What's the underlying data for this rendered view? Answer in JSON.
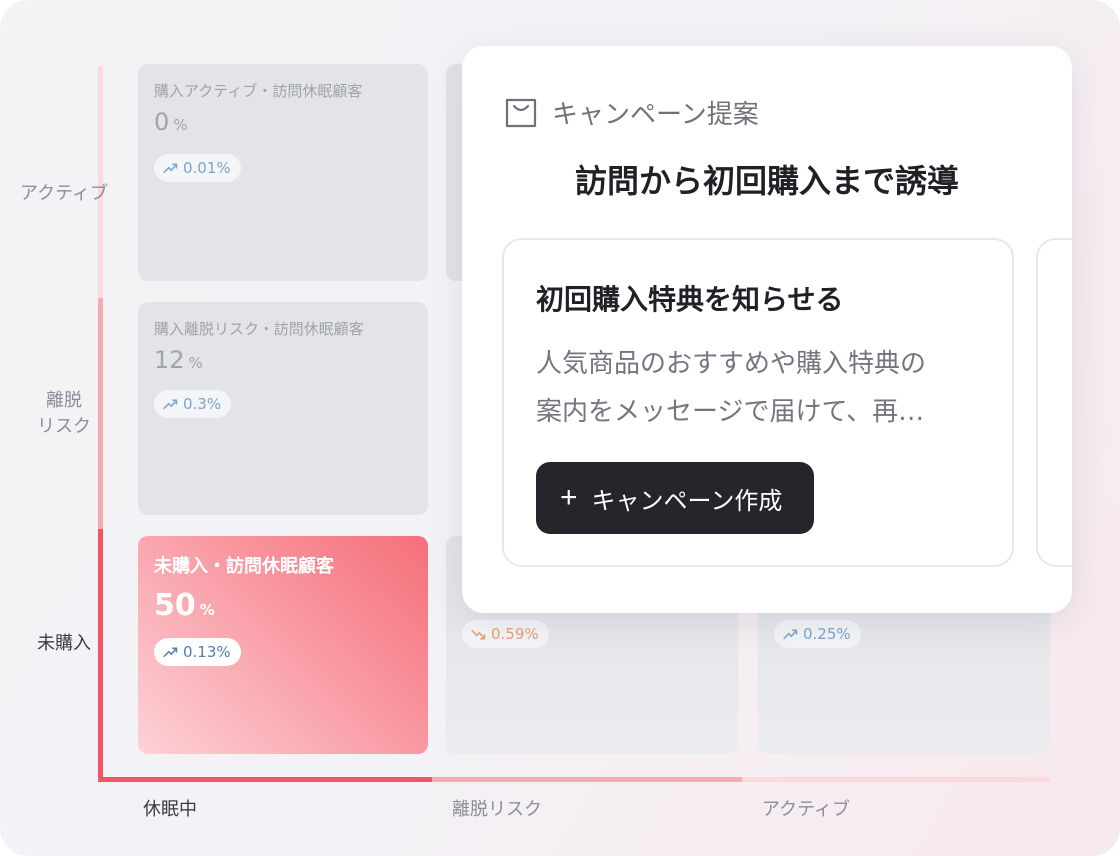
{
  "yaxis": [
    "アクティブ",
    "離脱\nリスク",
    "未購入"
  ],
  "xaxis": [
    "休眠中",
    "離脱リスク",
    "アクティブ"
  ],
  "cells": [
    {
      "title": "購入アクティブ・訪問休眠顧客",
      "pct": "0",
      "unit": "%",
      "trend": "0.01%",
      "trend_dir": "up"
    },
    {
      "title": "購入離脱リスク・訪問休眠顧客",
      "pct": "12",
      "unit": "%",
      "trend": "0.3%",
      "trend_dir": "up"
    },
    {
      "title": "未購入・訪問休眠顧客",
      "pct": "50",
      "unit": "%",
      "trend": "0.13%",
      "trend_dir": "up"
    },
    {
      "trend": "0.59%",
      "trend_dir": "down"
    },
    {
      "trend": "0.25%",
      "trend_dir": "up"
    }
  ],
  "card": {
    "icon": "shopping-bag-icon",
    "label": "キャンペーン提案",
    "title": "訪問から初回購入まで誘導",
    "suggestion": {
      "title": "初回購入特典を知らせる",
      "description_line1": "人気商品のおすすめや購入特典の",
      "description_line2": "案内をメッセージで届けて、再…",
      "button": "キャンペーン作成"
    }
  },
  "colors": {
    "accent": "#f0566a",
    "trend_up": "#7ea3cc",
    "trend_down": "#e8a070",
    "button": "#24262b"
  }
}
